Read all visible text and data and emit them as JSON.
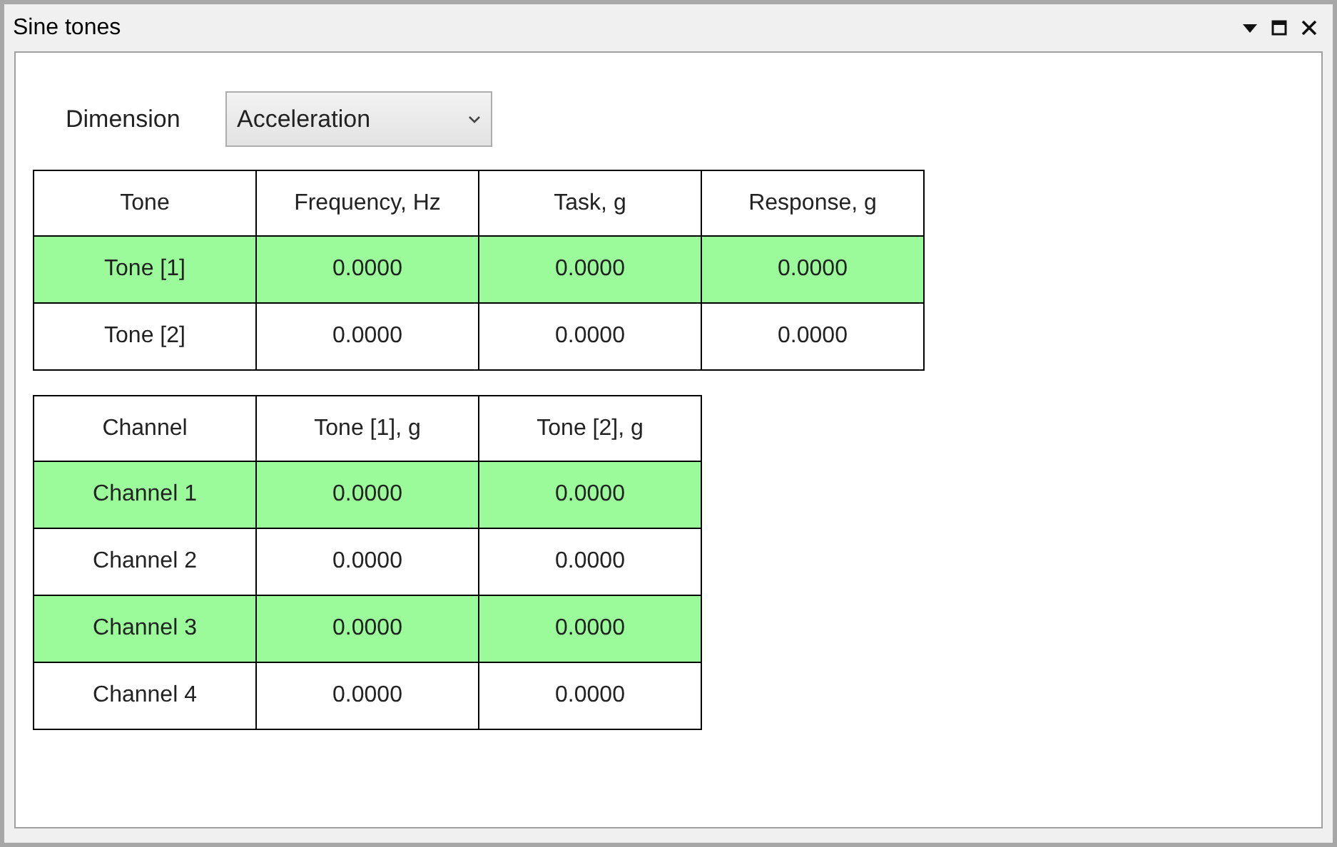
{
  "window": {
    "title": "Sine tones"
  },
  "dimension": {
    "label": "Dimension",
    "value": "Acceleration"
  },
  "tones_table": {
    "columns": [
      "Tone",
      "Frequency, Hz",
      "Task, g",
      "Response, g"
    ],
    "rows": [
      {
        "cells": [
          "Tone [1]",
          "0.0000",
          "0.0000",
          "0.0000"
        ],
        "highlighted": true
      },
      {
        "cells": [
          "Tone [2]",
          "0.0000",
          "0.0000",
          "0.0000"
        ],
        "highlighted": false
      }
    ]
  },
  "channels_table": {
    "columns": [
      "Channel",
      "Tone [1], g",
      "Tone [2], g"
    ],
    "rows": [
      {
        "cells": [
          "Channel 1",
          "0.0000",
          "0.0000"
        ],
        "highlighted": true
      },
      {
        "cells": [
          "Channel 2",
          "0.0000",
          "0.0000"
        ],
        "highlighted": false
      },
      {
        "cells": [
          "Channel 3",
          "0.0000",
          "0.0000"
        ],
        "highlighted": true
      },
      {
        "cells": [
          "Channel 4",
          "0.0000",
          "0.0000"
        ],
        "highlighted": false
      }
    ]
  }
}
